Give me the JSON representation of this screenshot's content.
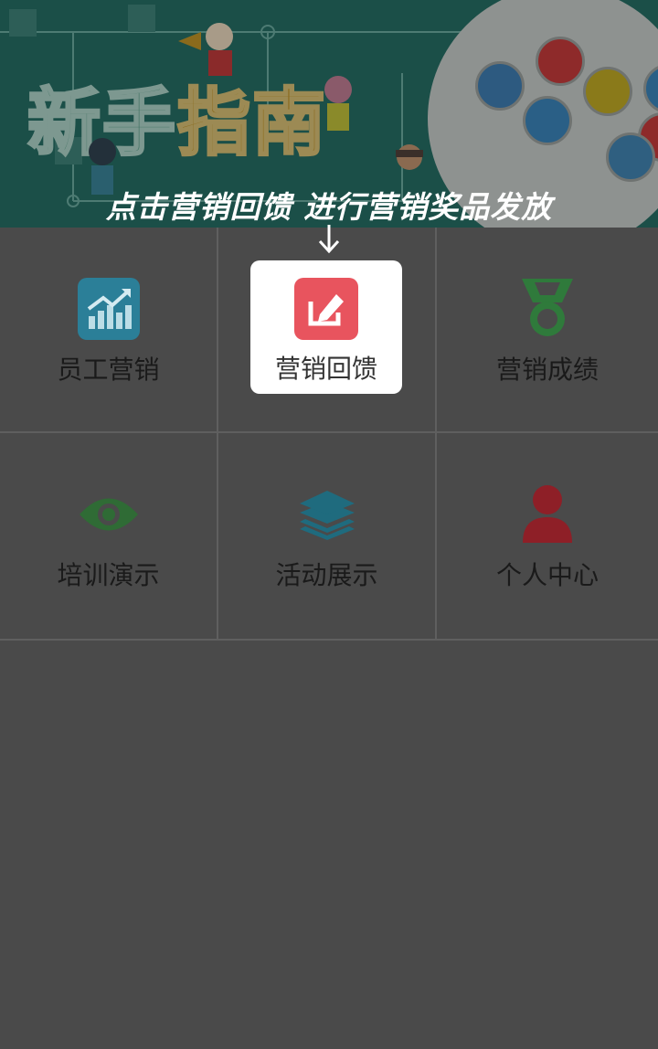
{
  "banner": {
    "title_part1": "新手",
    "title_part2": "指南"
  },
  "hint": {
    "text": "点击营销回馈  进行营销奖品发放"
  },
  "grid": {
    "items": [
      {
        "label": "员工营销",
        "icon": "chart-icon",
        "color": "#2b7f98"
      },
      {
        "label": "营销回馈",
        "icon": "edit-icon",
        "color": "#e8545e"
      },
      {
        "label": "营销成绩",
        "icon": "medal-icon",
        "color": "#2f7a3b"
      },
      {
        "label": "培训演示",
        "icon": "eye-icon",
        "color": "#2f6b35"
      },
      {
        "label": "活动展示",
        "icon": "layers-icon",
        "color": "#1f6b7e"
      },
      {
        "label": "个人中心",
        "icon": "person-icon",
        "color": "#8e1f27"
      }
    ]
  }
}
